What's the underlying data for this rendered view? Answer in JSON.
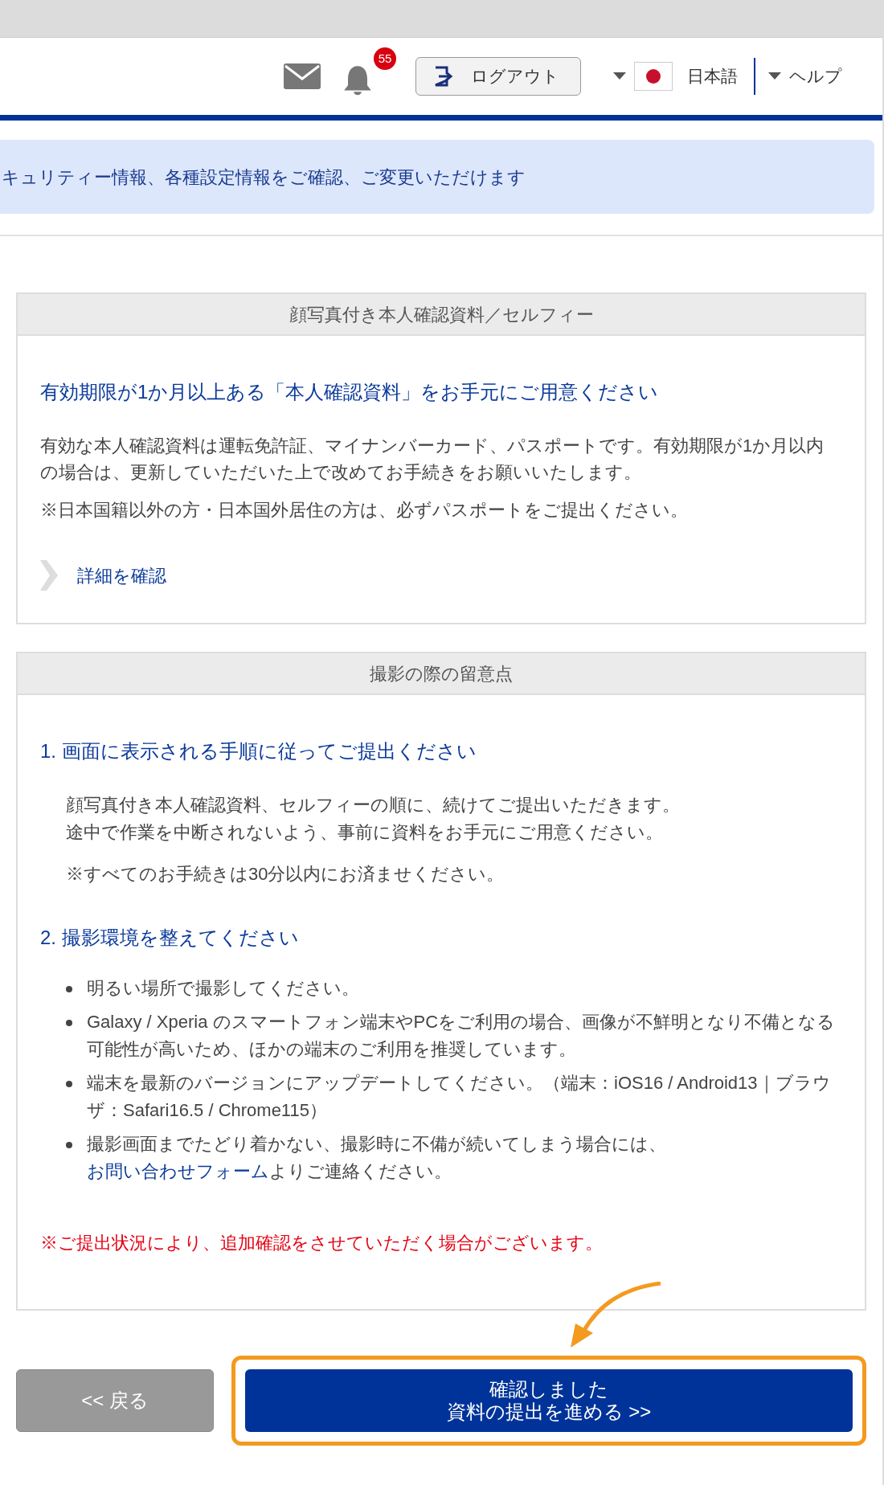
{
  "header": {
    "notification_count": "55",
    "logout": "ログアウト",
    "language": "日本語",
    "help": "ヘルプ"
  },
  "banner": "キュリティー情報、各種設定情報をご確認、ご変更いただけます",
  "id_card": {
    "title": "顔写真付き本人確認資料／セルフィー",
    "heading": "有効期限が1か月以上ある「本人確認資料」をお手元にご用意ください",
    "paragraphs": [
      "有効な本人確認資料は運転免許証、マイナンバーカード、パスポートです。有効期限が1か月以内の場合は、更新していただいた上で改めてお手続きをお願いいたします。",
      "※日本国籍以外の方・日本国外居住の方は、必ずパスポートをご提出ください。"
    ],
    "link": "詳細を確認"
  },
  "notes_card": {
    "title": "撮影の際の留意点",
    "sections": [
      {
        "heading": "1. 画面に表示される手順に従ってご提出ください",
        "kind": "text",
        "paragraphs": [
          {
            "lines": [
              "顔写真付き本人確認資料、セルフィーの順に、続けてご提出いただきます。",
              "途中で作業を中断されないよう、事前に資料をお手元にご用意ください。"
            ]
          },
          {
            "lines": [
              "※すべてのお手続きは30分以内にお済ませください。"
            ]
          }
        ]
      },
      {
        "heading": "2. 撮影環境を整えてください",
        "kind": "bullets",
        "items": [
          {
            "text": "明るい場所で撮影してください。"
          },
          {
            "text": "Galaxy / Xperia のスマートフォン端末やPCをご利用の場合、画像が不鮮明となり不備となる可能性が高いため、ほかの端末のご利用を推奨しています。"
          },
          {
            "text": "端末を最新のバージョンにアップデートしてください。（端末：iOS16 / Android13｜ブラウザ：Safari16.5 / Chrome115）"
          },
          {
            "text": "撮影画面までたどり着かない、撮影時に不備が続いてしまう場合には、",
            "link": "お問い合わせフォーム",
            "text_after": "よりご連絡ください。"
          }
        ]
      }
    ],
    "warning": "※ご提出状況により、追加確認をさせていただく場合がございます。"
  },
  "buttons": {
    "back": "<< 戻る",
    "proceed_lines": [
      "確認しました",
      "資料の提出を進める >>"
    ],
    "highlighted": true
  }
}
